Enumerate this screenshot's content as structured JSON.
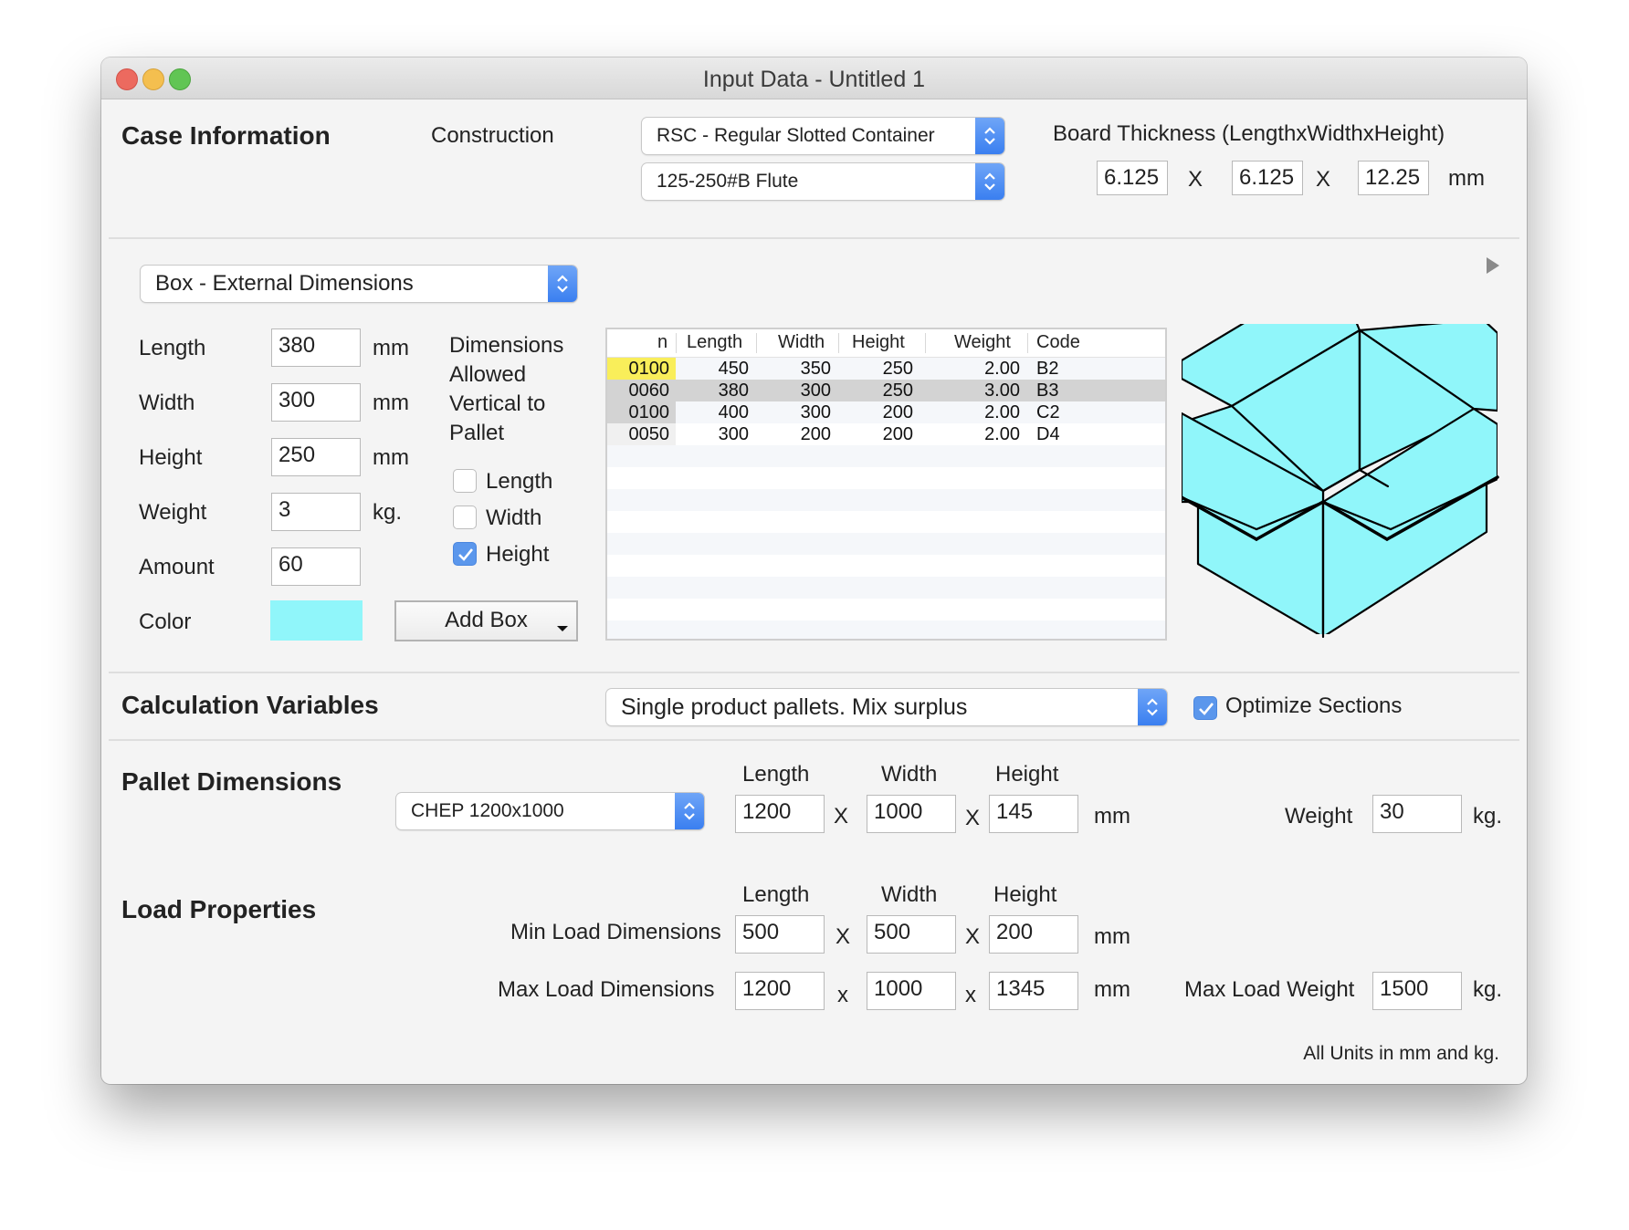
{
  "window": {
    "title": "Input Data - Untitled 1",
    "controls": [
      "close",
      "minimize",
      "zoom"
    ]
  },
  "case_information": {
    "heading": "Case Information",
    "construction_label": "Construction",
    "construction_value": "RSC - Regular Slotted Container",
    "flute_value": "125-250#B Flute",
    "board_thickness_label": "Board Thickness (LengthxWidthxHeight)",
    "board_thickness": {
      "length": "6.125",
      "width": "6.125",
      "height": "12.25",
      "separator": "X",
      "unit": "mm"
    }
  },
  "box": {
    "dimension_type": "Box - External Dimensions",
    "expand_icon": "disclosure-triangle-right",
    "fields": [
      {
        "label": "Length",
        "value": "380",
        "unit": "mm"
      },
      {
        "label": "Width",
        "value": "300",
        "unit": "mm"
      },
      {
        "label": "Height",
        "value": "250",
        "unit": "mm"
      },
      {
        "label": "Weight",
        "value": "3",
        "unit": "kg."
      },
      {
        "label": "Amount",
        "value": "60",
        "unit": ""
      }
    ],
    "color_label": "Color",
    "color_value": "#90f6fa",
    "vertical_label_lines": [
      "Dimensions",
      "Allowed",
      "Vertical to",
      "Pallet"
    ],
    "vertical_options": [
      {
        "label": "Length",
        "checked": false
      },
      {
        "label": "Width",
        "checked": false
      },
      {
        "label": "Height",
        "checked": true
      }
    ],
    "add_button": "Add Box",
    "add_button_icon": "dropdown-arrow"
  },
  "box_table": {
    "columns": [
      "n",
      "Length",
      "Width",
      "Height",
      "Weight",
      "Code"
    ],
    "rows": [
      {
        "n": "0100",
        "length": "450",
        "width": "350",
        "height": "250",
        "weight": "2.00",
        "code": "B2",
        "n_highlight": "#f9ee5a"
      },
      {
        "n": "0060",
        "length": "380",
        "width": "300",
        "height": "250",
        "weight": "3.00",
        "code": "B3",
        "selected": true
      },
      {
        "n": "0100",
        "length": "400",
        "width": "300",
        "height": "200",
        "weight": "2.00",
        "code": "C2"
      },
      {
        "n": "0050",
        "length": "300",
        "width": "200",
        "height": "200",
        "weight": "2.00",
        "code": "D4"
      }
    ]
  },
  "box_preview": {
    "fill": "#90f6fa",
    "stroke": "#000000",
    "icon": "open-box-illustration"
  },
  "calculation": {
    "heading": "Calculation Variables",
    "mode_value": "Single product pallets. Mix surplus",
    "optimize_label": "Optimize Sections",
    "optimize_checked": true
  },
  "pallet": {
    "heading": "Pallet Dimensions",
    "type_value": "CHEP 1200x1000",
    "col_labels": [
      "Length",
      "Width",
      "Height"
    ],
    "length": "1200",
    "width": "1000",
    "height": "145",
    "separator": "X",
    "unit": "mm",
    "weight_label": "Weight",
    "weight": "30",
    "weight_unit": "kg."
  },
  "load": {
    "heading": "Load Properties",
    "col_labels": [
      "Length",
      "Width",
      "Height"
    ],
    "min_label": "Min Load Dimensions",
    "min": {
      "length": "500",
      "width": "500",
      "height": "200"
    },
    "min_separator": "X",
    "max_label": "Max Load Dimensions",
    "max": {
      "length": "1200",
      "width": "1000",
      "height": "1345"
    },
    "max_separator": "x",
    "unit": "mm",
    "max_weight_label": "Max Load Weight",
    "max_weight": "1500",
    "weight_unit": "kg.",
    "footnote": "All Units in mm and kg."
  },
  "accent_color": "#3a7ff0"
}
